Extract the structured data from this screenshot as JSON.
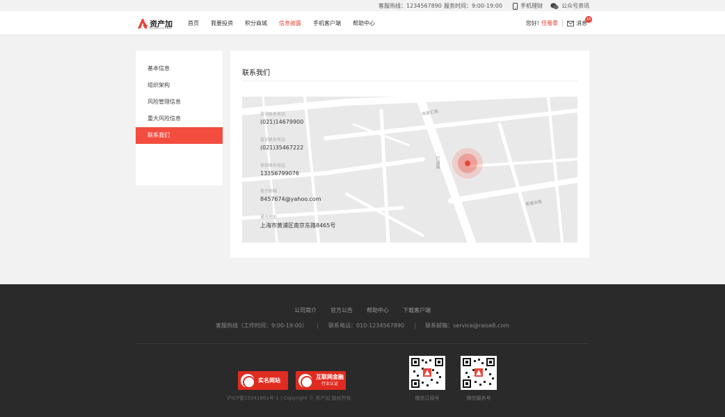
{
  "topbar": {
    "hotline": "客服热线：1234567890",
    "service_hours": "服务时间：9:00-19:00",
    "mobile_finance": "手机理财",
    "public_account": "公众号资讯"
  },
  "header": {
    "logo_text": "资产加",
    "logo_sub": "Assets increase",
    "nav": [
      {
        "label": "首页"
      },
      {
        "label": "我要投资"
      },
      {
        "label": "积分商城"
      },
      {
        "label": "信息披露"
      },
      {
        "label": "手机客户端"
      },
      {
        "label": "帮助中心"
      }
    ],
    "active_nav": "信息披露",
    "greeting": "您好!",
    "username": "怪蜀黍",
    "messages_label": "消息",
    "messages_count": "16"
  },
  "sidebar": {
    "items": [
      {
        "label": "基本信息"
      },
      {
        "label": "组织架构"
      },
      {
        "label": "风险管理信息"
      },
      {
        "label": "重大风险信息"
      },
      {
        "label": "联系我们"
      }
    ],
    "active_item": "联系我们"
  },
  "panel": {
    "title": "联系我们",
    "contacts": [
      {
        "label": "咨询联系电话",
        "value": "(021)14679900"
      },
      {
        "label": "投诉联系电话",
        "value": "(021)35467222"
      },
      {
        "label": "审核联系电话",
        "value": "13356799076"
      },
      {
        "label": "电子邮箱",
        "value": "8457674@yahoo.com"
      },
      {
        "label": "通讯地址",
        "value": "上海市黄浦区南京东路8465号"
      }
    ],
    "streets": [
      "徐家汇路",
      "打浦路",
      "南塘浜路"
    ]
  },
  "footer": {
    "links": [
      "公司简介",
      "官方公告",
      "帮助中心",
      "下载客户端"
    ],
    "hotline": "客服热线（工作时间：9:00-19:00）",
    "phone": "联系电话：010-1234567890",
    "email": "联系邮箱：service@raise8.com",
    "cert1": "实名网站",
    "cert2_title": "互联网金融",
    "cert2_sub": "行业认证",
    "copyright": "沪ICP备15041861号-1 | Copyright © 资产加 版权所有",
    "qr1_caption": "微信订阅号",
    "qr2_caption": "微信服务号"
  },
  "colors": {
    "accent": "#e8463b",
    "footer_bg": "#2a2a2a"
  }
}
